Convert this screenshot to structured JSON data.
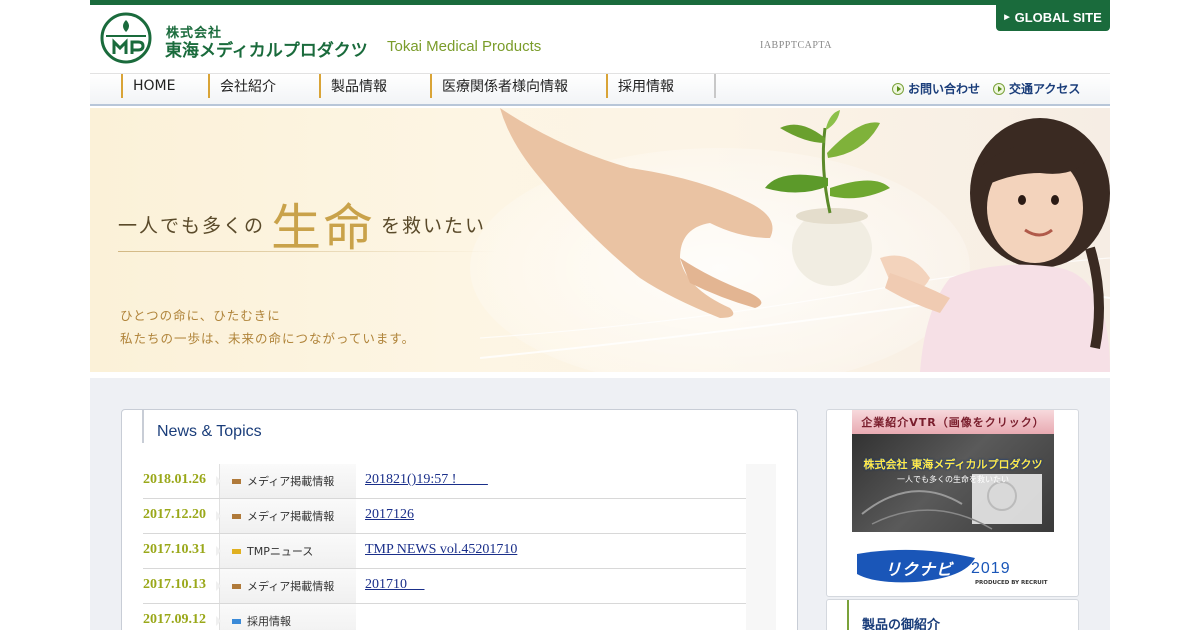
{
  "header": {
    "logo_kabushiki": "株式会社",
    "logo_name_jp": "東海メディカルプロダクツ",
    "logo_name_en": "Tokai Medical Products",
    "captcha_text": "IABPPTCAPTA",
    "global_site_label": "GLOBAL SITE"
  },
  "nav": {
    "items": [
      {
        "label": "HOME"
      },
      {
        "label": "会社紹介"
      },
      {
        "label": "製品情報"
      },
      {
        "label": "医療関係者様向情報"
      },
      {
        "label": "採用情報"
      }
    ],
    "contact_label": "お問い合わせ",
    "access_label": "交通アクセス"
  },
  "hero": {
    "tag_before": "一人でも多くの",
    "tag_main": "生命",
    "tag_after": "を救いたい",
    "sub_line1": "ひとつの命に、ひたむきに",
    "sub_line2": "私たちの一歩は、未来の命につながっています。"
  },
  "news": {
    "title": "News & Topics",
    "rows": [
      {
        "date": "2018.01.26",
        "category": "メディア掲載情報",
        "category_color": "#b07a3a",
        "text": "201821()19:57 !         "
      },
      {
        "date": "2017.12.20",
        "category": "メディア掲載情報",
        "category_color": "#b07a3a",
        "text": "2017126"
      },
      {
        "date": "2017.10.31",
        "category": "TMPニュース",
        "category_color": "#e0b020",
        "text": "TMP NEWS vol.45201710"
      },
      {
        "date": "2017.10.13",
        "category": "メディア掲載情報",
        "category_color": "#b07a3a",
        "text": "201710     "
      },
      {
        "date": "2017.09.12",
        "category": "採用情報",
        "category_color": "#3a8ad8",
        "text": ""
      }
    ]
  },
  "sidebar": {
    "vtr_banner": "企業紹介VTR（画像をクリック）",
    "vtr_company": "株式会社 東海メディカルプロダクツ",
    "vtr_slogan": "一人でも多くの生命を救いたい",
    "rikunabi_name": "リクナビ",
    "rikunabi_year": "2019",
    "rikunabi_by": "PRODUCED BY RECRUIT",
    "products_title": "製品の御紹介"
  },
  "colors": {
    "brand_green": "#1a6b3c",
    "accent_gold": "#c9a24a",
    "date_olive": "#9aa81a",
    "link_blue": "#1a2f8a"
  }
}
